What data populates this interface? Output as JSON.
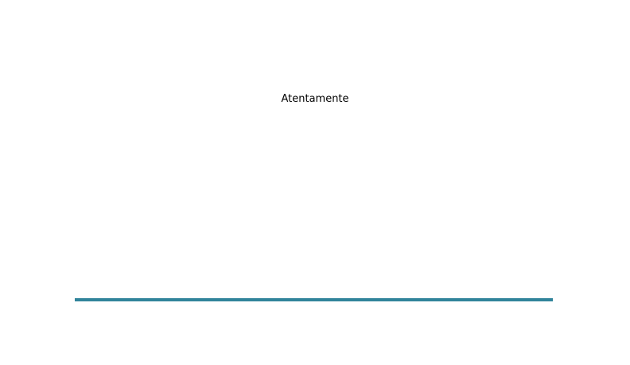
{
  "letter": {
    "closing": "Atentamente"
  },
  "colors": {
    "rule": "#31849b",
    "text": "#000000",
    "background": "#ffffff"
  }
}
